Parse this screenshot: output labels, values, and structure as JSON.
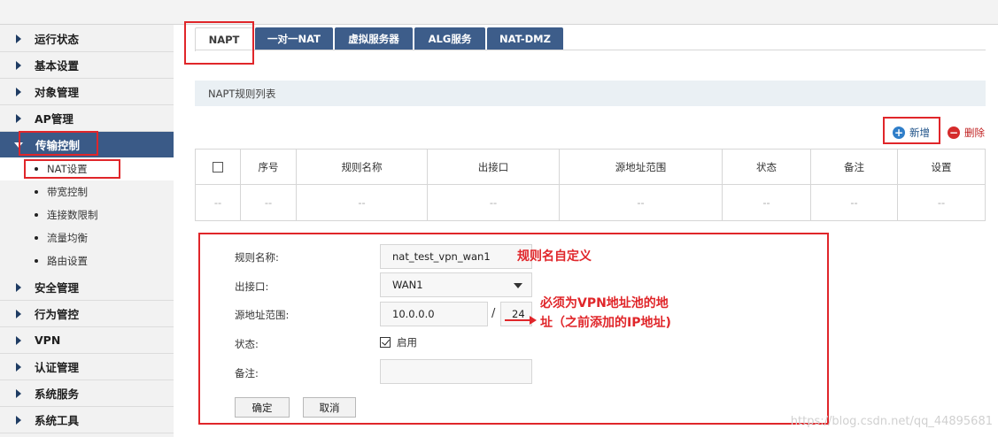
{
  "sidebar": {
    "items": [
      {
        "label": "运行状态"
      },
      {
        "label": "基本设置"
      },
      {
        "label": "对象管理"
      },
      {
        "label": "AP管理"
      },
      {
        "label": "传输控制"
      },
      {
        "label": "安全管理"
      },
      {
        "label": "行为管控"
      },
      {
        "label": "VPN"
      },
      {
        "label": "认证管理"
      },
      {
        "label": "系统服务"
      },
      {
        "label": "系统工具"
      }
    ],
    "sub_items": [
      {
        "label": "NAT设置"
      },
      {
        "label": "带宽控制"
      },
      {
        "label": "连接数限制"
      },
      {
        "label": "流量均衡"
      },
      {
        "label": "路由设置"
      }
    ]
  },
  "tabs": [
    {
      "label": "NAPT"
    },
    {
      "label": "一对一NAT"
    },
    {
      "label": "虚拟服务器"
    },
    {
      "label": "ALG服务"
    },
    {
      "label": "NAT-DMZ"
    }
  ],
  "panel": {
    "title": "NAPT规则列表",
    "add_label": "新增",
    "delete_label": "删除"
  },
  "table": {
    "columns": [
      "序号",
      "规则名称",
      "出接口",
      "源地址范围",
      "状态",
      "备注",
      "设置"
    ],
    "empty_row": [
      "--",
      "--",
      "--",
      "--",
      "--",
      "--",
      "--",
      "--"
    ]
  },
  "form": {
    "rule_name_label": "规则名称:",
    "rule_name_value": "nat_test_vpn_wan1",
    "out_iface_label": "出接口:",
    "out_iface_value": "WAN1",
    "src_range_label": "源地址范围:",
    "src_ip_value": "10.0.0.0",
    "src_sep": "/",
    "src_mask_value": "24",
    "status_label": "状态:",
    "status_check_label": "启用",
    "status_enabled": true,
    "remark_label": "备注:",
    "remark_value": "",
    "ok_label": "确定",
    "cancel_label": "取消"
  },
  "annotations": {
    "note1": "规则名自定义",
    "note2_line1": "必须为VPN地址池的地",
    "note2_line2": "址（之前添加的IP地址)",
    "color": "#e0262a"
  },
  "watermark": "https://blog.csdn.net/qq_44895681"
}
